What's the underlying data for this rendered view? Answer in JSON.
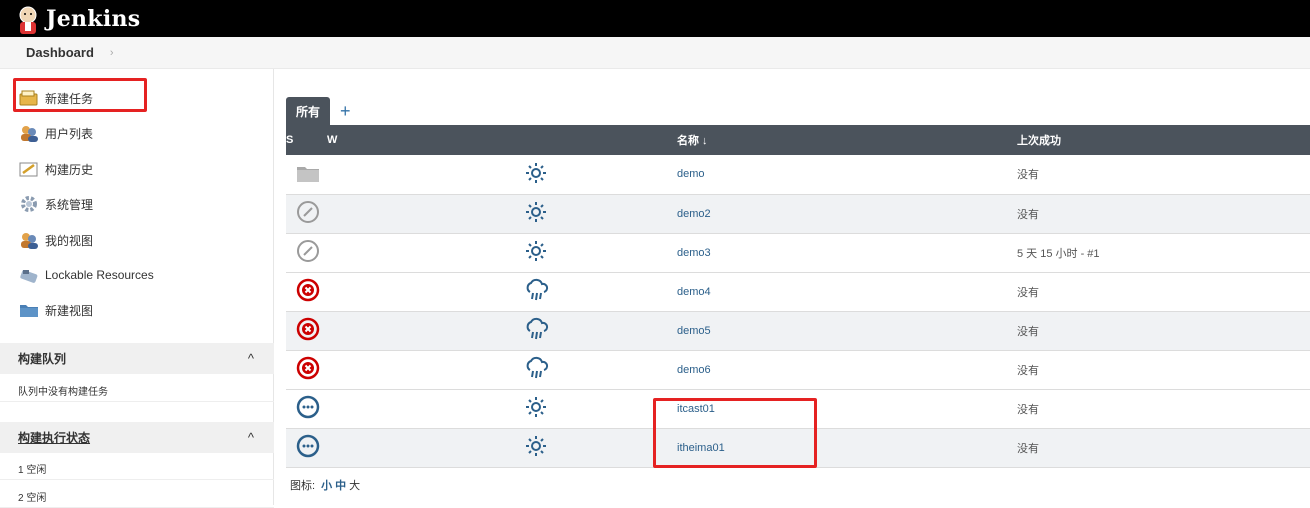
{
  "app": {
    "brand": "Jenkins"
  },
  "breadcrumb": {
    "root": "Dashboard",
    "sep": "›"
  },
  "sidebar": {
    "tasks": [
      {
        "label": "新建任务",
        "icon": "new-item-icon"
      },
      {
        "label": "用户列表",
        "icon": "users-icon"
      },
      {
        "label": "构建历史",
        "icon": "build-history-icon"
      },
      {
        "label": "系统管理",
        "icon": "manage-gear-icon"
      },
      {
        "label": "我的视图",
        "icon": "my-views-icon"
      },
      {
        "label": "Lockable Resources",
        "icon": "lockable-resources-icon"
      },
      {
        "label": "新建视图",
        "icon": "new-view-folder-icon"
      }
    ],
    "queue": {
      "title": "构建队列",
      "empty": "队列中没有构建任务",
      "chevron": "^"
    },
    "executors": {
      "title": "构建执行状态",
      "chevron": "^",
      "rows": [
        "1  空闲",
        "2  空闲"
      ]
    }
  },
  "tabs": {
    "all": "所有",
    "add": "+"
  },
  "table": {
    "headers": {
      "s": "S",
      "w": "W",
      "name": "名称 ↓",
      "last_success": "上次成功"
    },
    "rows": [
      {
        "status": "folder",
        "weather": "sunny",
        "name": "demo",
        "last_success": "没有"
      },
      {
        "status": "disabled",
        "weather": "sunny",
        "name": "demo2",
        "last_success": "没有"
      },
      {
        "status": "disabled",
        "weather": "sunny",
        "name": "demo3",
        "last_success": "5 天 15 小时 - #1"
      },
      {
        "status": "failed",
        "weather": "storm",
        "name": "demo4",
        "last_success": "没有"
      },
      {
        "status": "failed",
        "weather": "storm",
        "name": "demo5",
        "last_success": "没有"
      },
      {
        "status": "failed",
        "weather": "storm",
        "name": "demo6",
        "last_success": "没有"
      },
      {
        "status": "notbuilt",
        "weather": "sunny",
        "name": "itcast01",
        "last_success": "没有"
      },
      {
        "status": "notbuilt",
        "weather": "sunny",
        "name": "itheima01",
        "last_success": "没有"
      }
    ]
  },
  "icon_size": {
    "label": "图标:",
    "small": "小",
    "medium": "中",
    "large": "大"
  },
  "colors": {
    "topbar": "#000000",
    "header": "#4b535c",
    "link": "#2b5f8a",
    "failed": "#cc0000",
    "blue": "#2b5f8a",
    "annotation": "#e52222"
  }
}
